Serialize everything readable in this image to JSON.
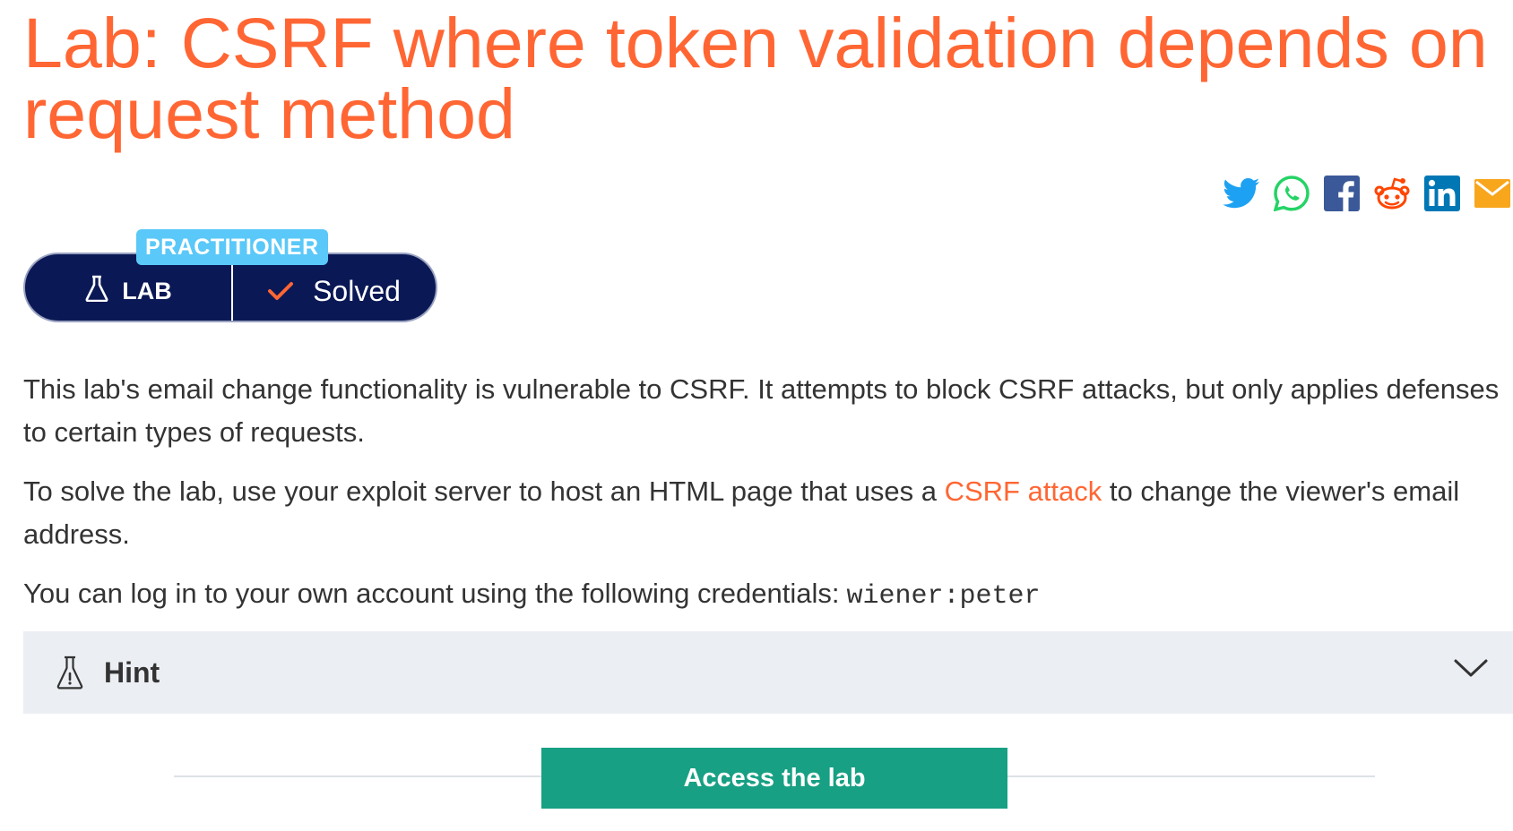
{
  "page": {
    "title": "Lab: CSRF where token validation depends on request method"
  },
  "share": {
    "icons": [
      "twitter-icon",
      "whatsapp-icon",
      "facebook-icon",
      "reddit-icon",
      "linkedin-icon",
      "email-icon"
    ]
  },
  "badge": {
    "level": "PRACTITIONER",
    "type_label": "LAB",
    "status_label": "Solved"
  },
  "description": {
    "p1": "This lab's email change functionality is vulnerable to CSRF. It attempts to block CSRF attacks, but only applies defenses to certain types of requests.",
    "p2_before": "To solve the lab, use your exploit server to host an HTML page that uses a ",
    "p2_link": "CSRF attack",
    "p2_after": " to change the viewer's email address.",
    "p3_text": "You can log in to your own account using the following credentials:",
    "p3_credentials": "wiener:peter"
  },
  "hint": {
    "label": "Hint"
  },
  "actions": {
    "access_label": "Access the lab"
  },
  "colors": {
    "accent": "#ff6633",
    "navy": "#0a1855",
    "level_tag": "#5ac8f8",
    "access_button": "#17a083",
    "hint_bg": "#ebeef2"
  }
}
